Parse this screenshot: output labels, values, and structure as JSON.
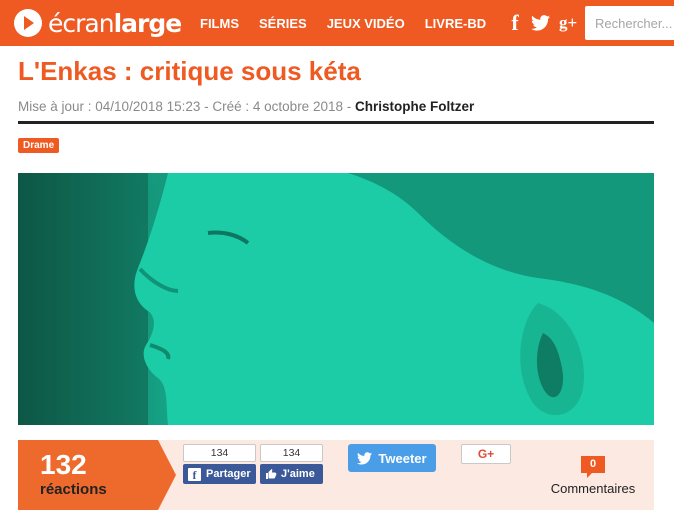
{
  "header": {
    "logo": {
      "light": "écran",
      "bold": "large"
    },
    "nav": [
      "FILMS",
      "SÉRIES",
      "JEUX VIDÉO",
      "LIVRE-BD"
    ],
    "social": [
      "facebook-icon",
      "twitter-icon",
      "google-plus-icon"
    ],
    "search_placeholder": "Rechercher..."
  },
  "article": {
    "title": "L'Enkas : critique sous kéta",
    "meta": {
      "updated_label": "Mise à jour : ",
      "updated_value": "04/10/2018 15:23",
      "created_label": " - Créé : ",
      "created_value": "4 octobre 2018",
      "sep": " - ",
      "author": "Christophe Foltzer"
    },
    "tag": "Drame"
  },
  "reactions": {
    "count": "132",
    "label": "réactions",
    "facebook_share": {
      "count": "134",
      "label": "Partager"
    },
    "facebook_like": {
      "count": "134",
      "label": "J'aime"
    },
    "tweet_label": "Tweeter",
    "gplus_label": "G+",
    "comments": {
      "count": "0",
      "label": "Commentaires"
    }
  },
  "colors": {
    "brand": "#ee5a22",
    "facebook": "#3b5998",
    "twitter": "#4a9ee8",
    "hero_tint": "#1ac8a4"
  }
}
